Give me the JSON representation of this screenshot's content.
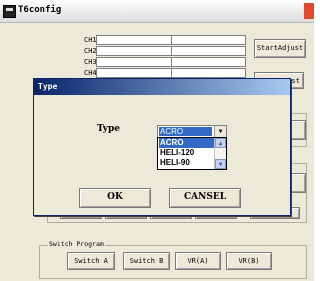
{
  "window": {
    "title": "T6config"
  },
  "channels": {
    "ch1": "CH1",
    "ch2": "CH2",
    "ch3": "CH3",
    "ch4": "CH4"
  },
  "buttons": {
    "start_adjust": "StartAdjust",
    "end_adjust_partial": "ust"
  },
  "switch_program": {
    "label": "Switch Program",
    "switch_a": "Switch A",
    "switch_b": "Switch B",
    "vr_a": "VR(A)",
    "vr_b": "VR(B)"
  },
  "dialog": {
    "title": "Type",
    "type_label": "Type",
    "selected": "ACRO",
    "options": [
      "ACRO",
      "HELI-120",
      "HELI-90"
    ],
    "ok": "OK",
    "cancel": "CANSEL"
  },
  "colors": {
    "dialog_title": "#0a246a",
    "selection": "#316ac5",
    "window_bg": "#ece9d8"
  },
  "icons": [
    "app-icon",
    "close-icon",
    "dropdown-arrow-icon",
    "scroll-up-icon",
    "scroll-down-icon"
  ]
}
